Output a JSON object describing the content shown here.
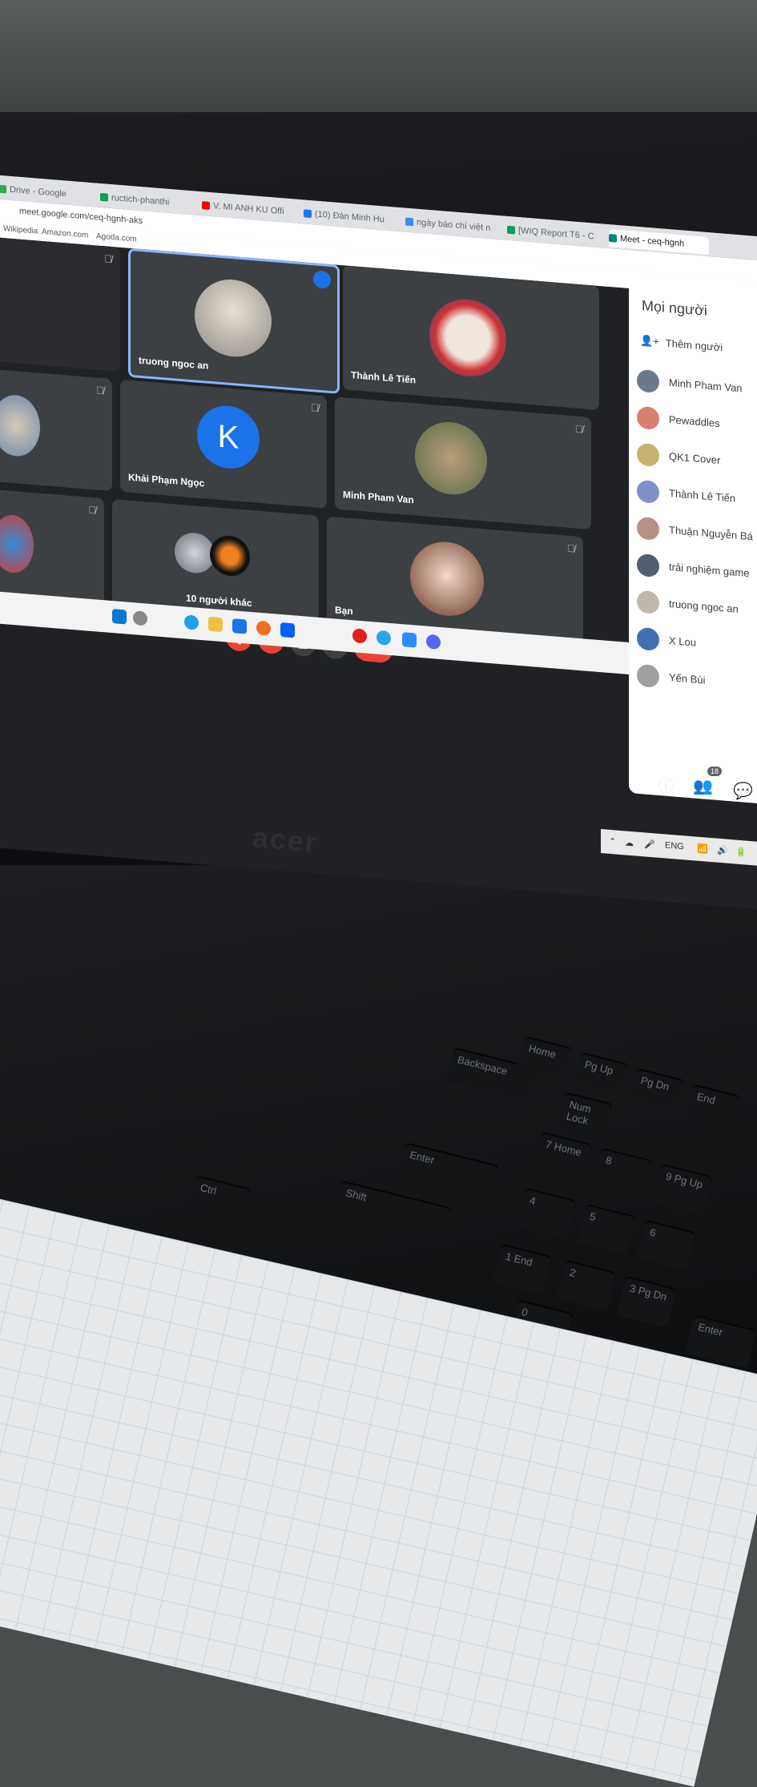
{
  "browser": {
    "tabs": [
      {
        "label": "Drive - Google",
        "color": "#34a853"
      },
      {
        "label": "ructich-phanthi",
        "color": "#0f9d58"
      },
      {
        "label": "V. MI ANH KU Offi",
        "color": "#ff0000"
      },
      {
        "label": "(10) Đàn Minh Hu",
        "color": "#1877f2"
      },
      {
        "label": "ngày báo chí việt n",
        "color": "#4285f4"
      },
      {
        "label": "[WIQ Report T6 - C",
        "color": "#0f9d58"
      },
      {
        "label": "Meet - ceq-hgnh",
        "color": "#00897b",
        "active": true
      }
    ],
    "url": "meet.google.com/ceq-hgnh-aks",
    "bookmarks": [
      "Wikipedia",
      "Amazon.com",
      "Agoda.com"
    ]
  },
  "meet": {
    "tiles": [
      {
        "name": "",
        "muted": true,
        "dark": true
      },
      {
        "name": "truong ngoc an",
        "speaking": true,
        "avatar": "photo"
      },
      {
        "name": "Thành Lê Tiến",
        "avatar": "photo"
      },
      {
        "name": "",
        "muted": true,
        "avatar": "photo"
      },
      {
        "name": "Khải Phạm Ngọc",
        "muted": true,
        "avatar_letter": "K"
      },
      {
        "name": "Minh Pham Van",
        "muted": true,
        "avatar": "photo"
      },
      {
        "name": "",
        "muted": true,
        "avatar": "photo"
      },
      {
        "name": "10 người khác",
        "avatar": "group"
      },
      {
        "name": "Bạn",
        "muted": true,
        "avatar": "photo"
      }
    ],
    "controls": [
      "mic-off",
      "camera-off",
      "present",
      "more",
      "hang-up"
    ]
  },
  "people_panel": {
    "title": "Mọi người",
    "add_label": "Thêm người",
    "participants": [
      {
        "name": "Minh Pham Van",
        "state": "none"
      },
      {
        "name": "Pewaddles",
        "state": "none"
      },
      {
        "name": "QK1 Cover",
        "state": "none"
      },
      {
        "name": "Thành Lê Tiến",
        "state": "speaking"
      },
      {
        "name": "Thuận Nguyễn Bá",
        "state": "muted"
      },
      {
        "name": "trải nghiệm game",
        "state": "muted"
      },
      {
        "name": "truong ngoc an",
        "state": "speaking"
      },
      {
        "name": "X Lou",
        "state": "muted"
      },
      {
        "name": "Yến Bùi",
        "state": "muted"
      }
    ],
    "people_count": "18"
  },
  "tray": {
    "language": "ENG"
  },
  "laptop": {
    "brand": "acer"
  },
  "keyboard": {
    "keys": [
      "Backspace",
      "Home",
      "Pg Up",
      "Pg Dn",
      "End",
      "Num Lock",
      "Enter",
      "Shift",
      "Ctrl",
      "7 Home",
      "8",
      "9 Pg Up",
      "4",
      "5",
      "6",
      "1 End",
      "2",
      "3 Pg Dn",
      "0",
      "Enter"
    ]
  }
}
